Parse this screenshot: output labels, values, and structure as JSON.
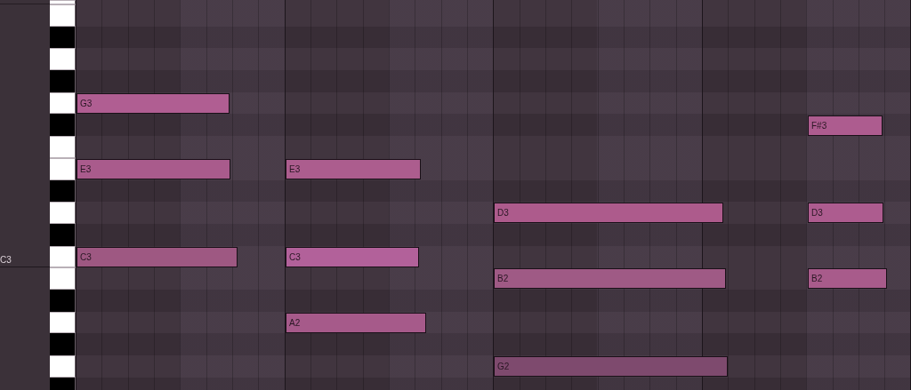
{
  "octave_label": "C3",
  "notes": [
    {
      "label": "G3",
      "color": "#b05e92"
    },
    {
      "label": "E3",
      "color": "#a95b8c"
    },
    {
      "label": "C3",
      "color": "#9e5882"
    },
    {
      "label": "E3",
      "color": "#ac5d8e"
    },
    {
      "label": "C3",
      "color": "#b2619a"
    },
    {
      "label": "A2",
      "color": "#a65a8a"
    },
    {
      "label": "D3",
      "color": "#ad5b8c"
    },
    {
      "label": "B2",
      "color": "#9f5a85"
    },
    {
      "label": "G2",
      "color": "#7e4a6e"
    },
    {
      "label": "F#3",
      "color": "#ad5c8f"
    },
    {
      "label": "D3",
      "color": "#ad5c8f"
    },
    {
      "label": "B2",
      "color": "#a85b8b"
    }
  ]
}
